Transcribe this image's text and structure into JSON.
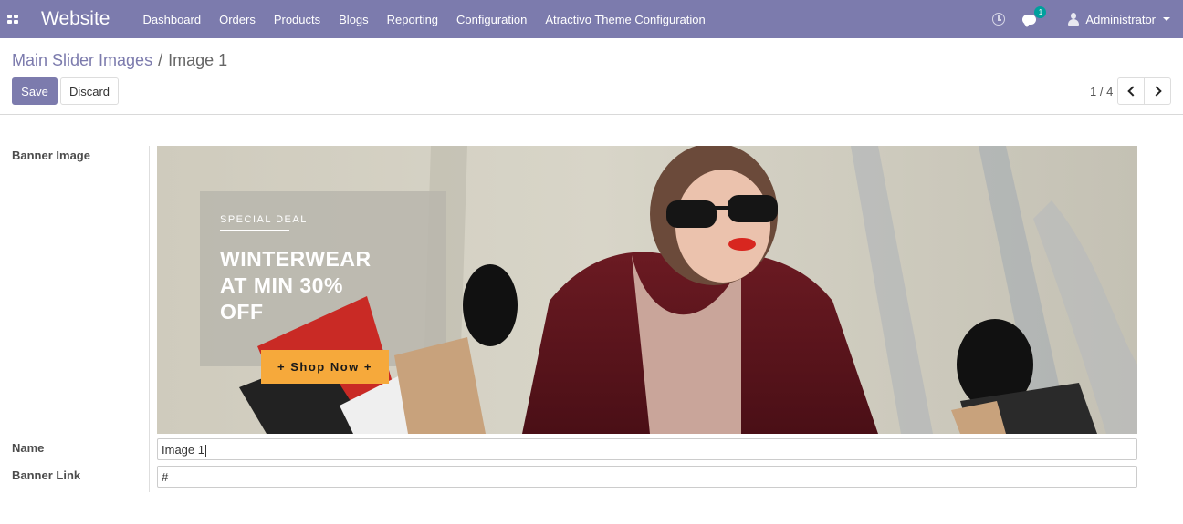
{
  "navbar": {
    "brand": "Website",
    "menu": [
      "Dashboard",
      "Orders",
      "Products",
      "Blogs",
      "Reporting",
      "Configuration",
      "Atractivo Theme Configuration"
    ],
    "chat_count": "1",
    "user": "Administrator"
  },
  "breadcrumb": {
    "parent": "Main Slider Images",
    "separator": "/",
    "current": "Image 1"
  },
  "buttons": {
    "save": "Save",
    "discard": "Discard"
  },
  "pager": {
    "value": "1 / 4"
  },
  "form": {
    "banner_label": "Banner Image",
    "name_label": "Name",
    "name_value": "Image 1",
    "link_label": "Banner Link",
    "link_value": "#"
  },
  "banner": {
    "kicker": "SPECIAL DEAL",
    "headline_lines": [
      "WINTERWEAR",
      "AT MIN 30%",
      "OFF"
    ],
    "cta": "+ Shop Now +"
  },
  "colors": {
    "navbar": "#7c7bad",
    "accent": "#7c7bad",
    "badge": "#00a09d",
    "cta": "#f6a93b"
  }
}
